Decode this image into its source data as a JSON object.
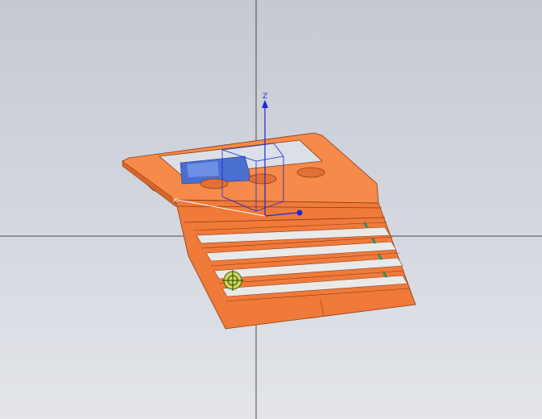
{
  "viewport": {
    "background_top": "#c6c9d2",
    "background_bottom": "#e3e5ea"
  },
  "part": {
    "body_color": "#f07a3a",
    "top_face_color": "#f58a4a",
    "shadow_color": "#d8652a",
    "edge_color": "#8a3a12",
    "cavity_color": "#4a6fd0",
    "slot_color": "#e9e9e9",
    "slot_end_color": "#2f8f6a"
  },
  "csys": {
    "z_label": "Z",
    "color": "#1a28d8"
  },
  "icons": {
    "crosshair": "crosshair-lines",
    "snap_target": "snap-target-icon",
    "coordinate_system": "csys-triad-icon"
  }
}
